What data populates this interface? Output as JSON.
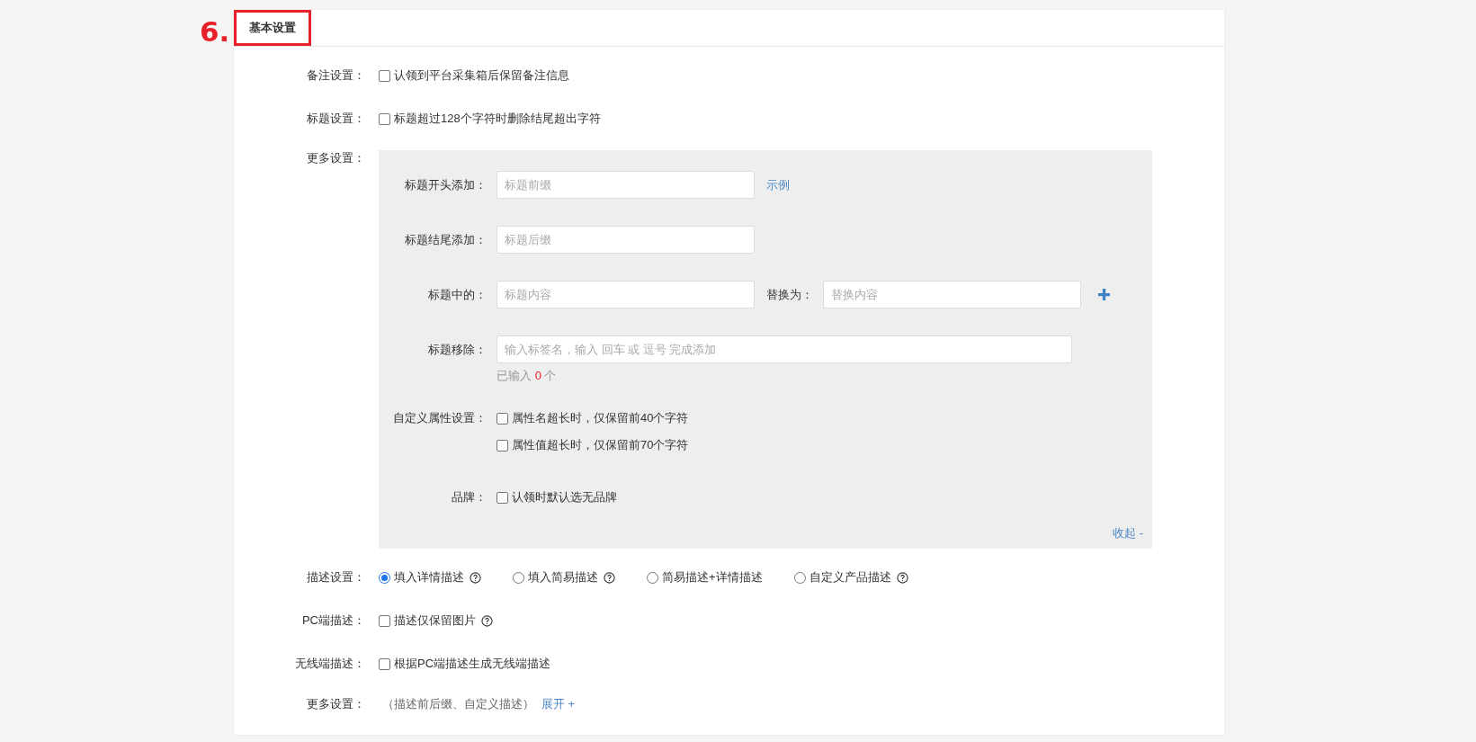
{
  "step_label": "6.",
  "section_tab": {
    "label": "基本设置",
    "highlighted": true
  },
  "settings": [
    {
      "kind": "checkbox",
      "label": "备注设置：",
      "options": [
        {
          "text": "认领到平台采集箱后保留备注信息",
          "checked": false,
          "help": false
        }
      ]
    },
    {
      "kind": "checkbox",
      "label": "标题设置：",
      "options": [
        {
          "text": "标题超过128个字符时删除结尾超出字符",
          "checked": false,
          "help": false
        }
      ]
    },
    {
      "kind": "panel",
      "label": "更多设置：",
      "panel": {
        "rows": [
          {
            "kind": "input",
            "label": "标题开头添加：",
            "placeholder": "标题前缀",
            "link": "示例"
          },
          {
            "kind": "input",
            "label": "标题结尾添加：",
            "placeholder": "标题后缀"
          },
          {
            "kind": "replace",
            "label": "标题中的：",
            "placeholder": "标题内容",
            "replace_label": "替换为：",
            "replace_placeholder": "替换内容"
          },
          {
            "kind": "tags",
            "label": "标题移除：",
            "placeholder": "输入标签名，输入 回车 或 逗号 完成添加",
            "count_prefix": "已输入",
            "count": "0",
            "count_suffix": "个"
          },
          {
            "kind": "checkboxes",
            "label": "自定义属性设置：",
            "options": [
              {
                "text": "属性名超长时，仅保留前40个字符",
                "checked": false
              },
              {
                "text": "属性值超长时，仅保留前70个字符",
                "checked": false
              }
            ]
          },
          {
            "kind": "checkboxes",
            "label": "品牌：",
            "options": [
              {
                "text": "认领时默认选无品牌",
                "checked": false
              }
            ]
          }
        ],
        "collapse_link": "收起 -"
      }
    },
    {
      "kind": "radio",
      "label": "描述设置：",
      "options": [
        {
          "text": "填入详情描述",
          "selected": true,
          "help": true
        },
        {
          "text": "填入简易描述",
          "selected": false,
          "help": true
        },
        {
          "text": "简易描述+详情描述",
          "selected": false,
          "help": false
        },
        {
          "text": "自定义产品描述",
          "selected": false,
          "help": true
        }
      ]
    },
    {
      "kind": "checkbox",
      "label": "PC端描述：",
      "options": [
        {
          "text": "描述仅保留图片",
          "checked": false,
          "help": true
        }
      ]
    },
    {
      "kind": "checkbox",
      "label": "无线端描述：",
      "options": [
        {
          "text": "根据PC端描述生成无线端描述",
          "checked": false,
          "help": false
        }
      ]
    },
    {
      "kind": "more",
      "label": "更多设置：",
      "note": "（描述前后缀、自定义描述）",
      "link": "展开 +"
    }
  ]
}
